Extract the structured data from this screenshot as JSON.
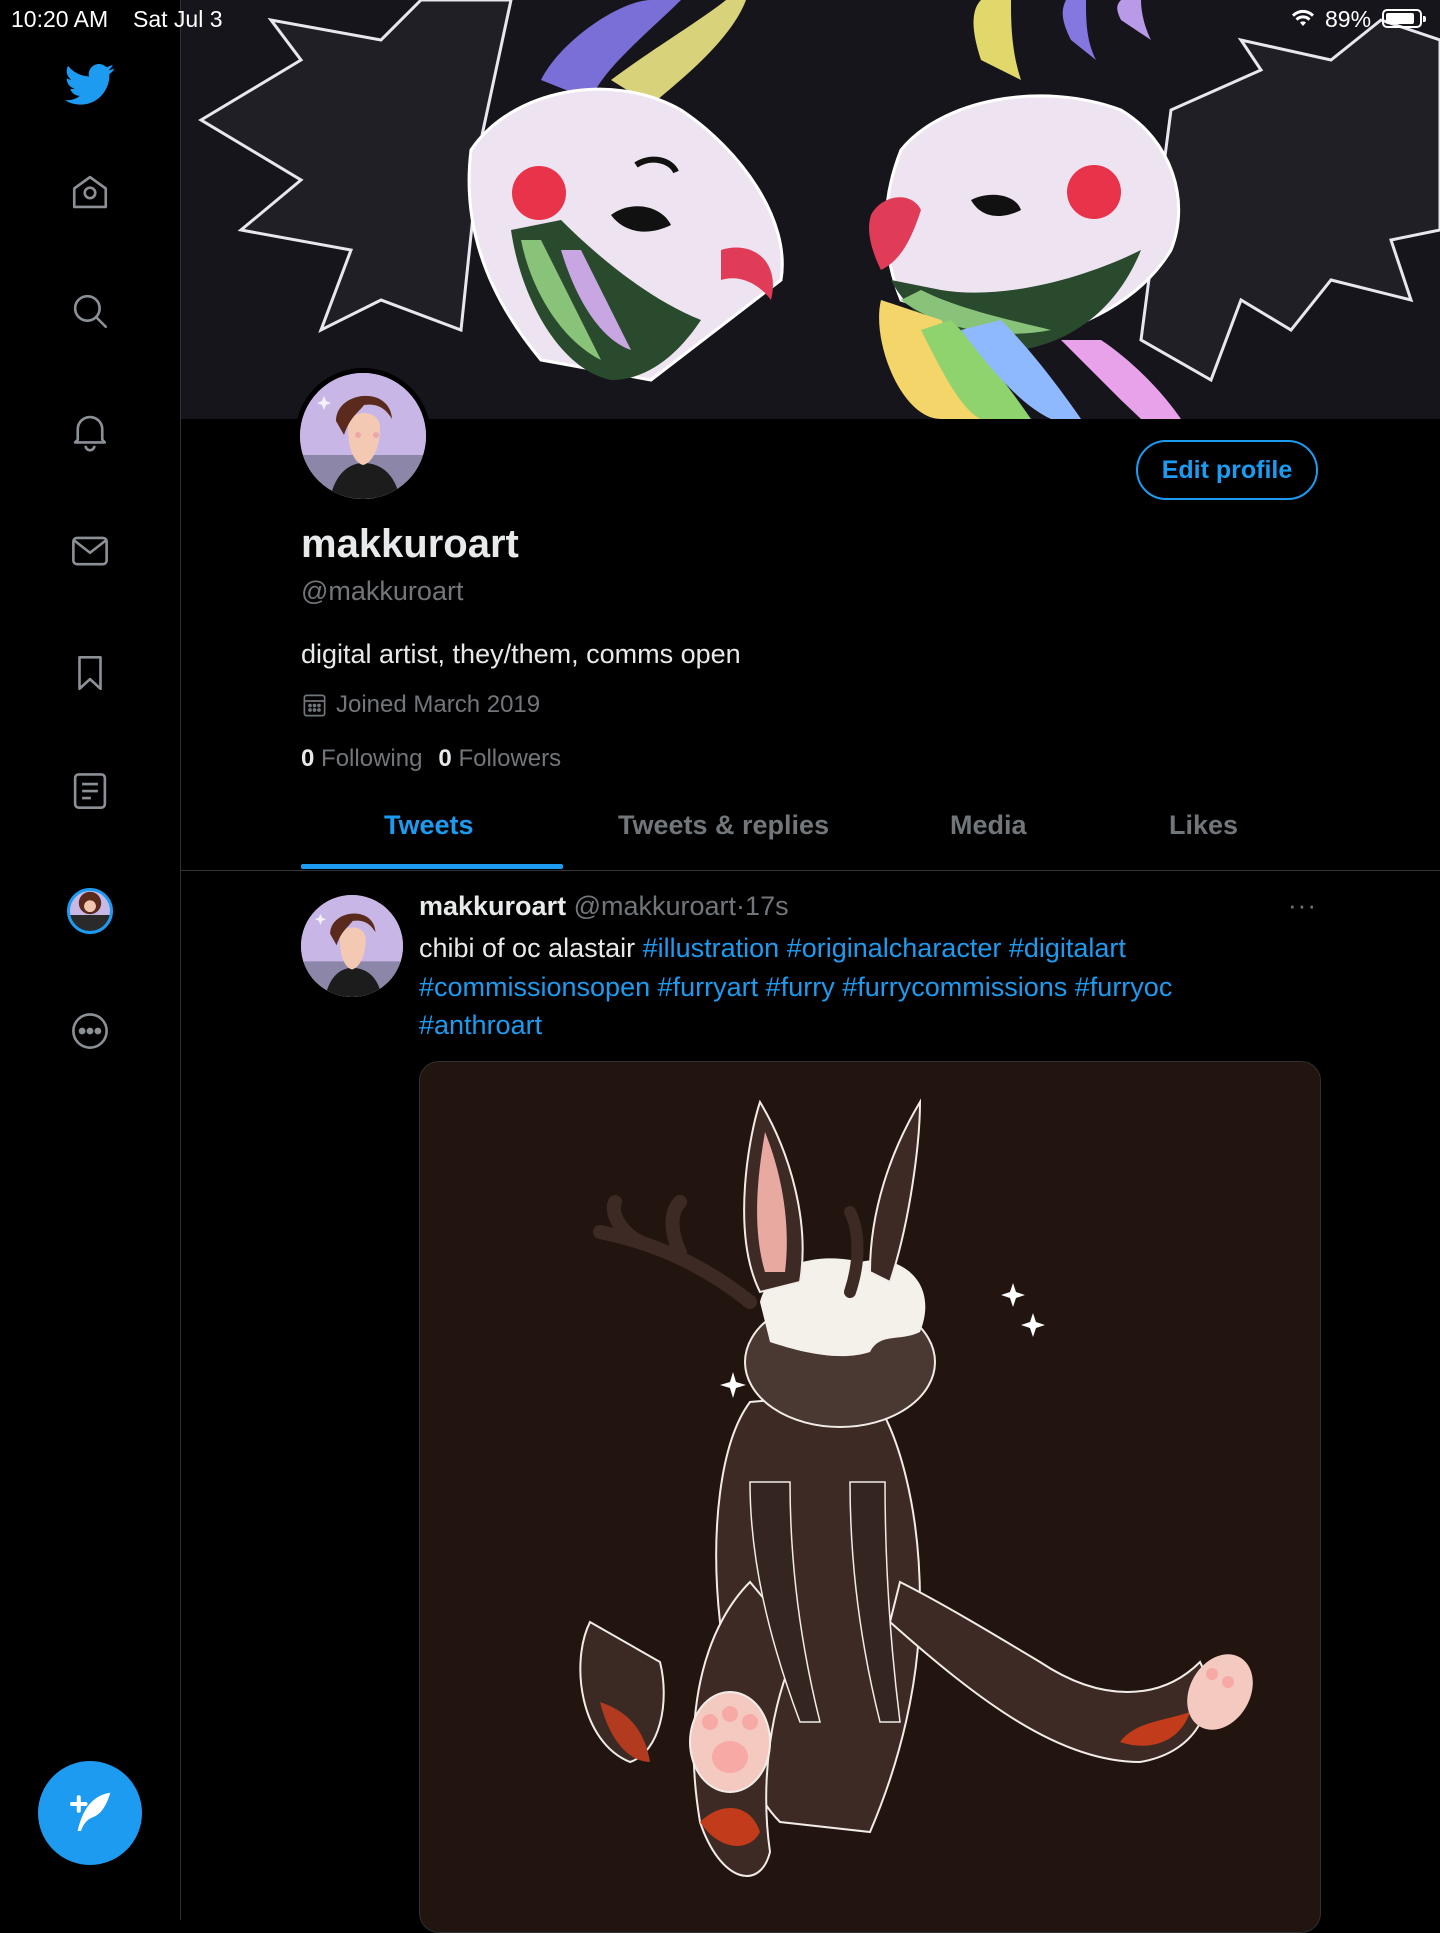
{
  "status_bar": {
    "time": "10:20 AM",
    "date": "Sat Jul 3",
    "battery_pct": "89%",
    "battery_level": 0.89
  },
  "sidebar": {
    "items": [
      {
        "icon": "twitter-logo-icon"
      },
      {
        "icon": "home-icon"
      },
      {
        "icon": "search-icon"
      },
      {
        "icon": "notifications-bell-icon"
      },
      {
        "icon": "messages-envelope-icon"
      },
      {
        "icon": "bookmark-icon"
      },
      {
        "icon": "lists-icon"
      },
      {
        "icon": "profile-avatar-icon"
      },
      {
        "icon": "more-icon"
      }
    ],
    "compose_icon": "compose-tweet-icon"
  },
  "profile": {
    "name": "makkuroart",
    "handle": "@makkuroart",
    "bio": "digital artist, they/them, comms open",
    "joined": "Joined March 2019",
    "following_count": "0",
    "following_label": "Following",
    "followers_count": "0",
    "followers_label": "Followers",
    "edit_button": "Edit profile"
  },
  "tabs": [
    {
      "label": "Tweets",
      "active": true
    },
    {
      "label": "Tweets & replies",
      "active": false
    },
    {
      "label": "Media",
      "active": false
    },
    {
      "label": "Likes",
      "active": false
    }
  ],
  "tweet": {
    "name": "makkuroart",
    "handle": "@makkuroart",
    "dot": "·",
    "time": "17s",
    "more": "···",
    "text": "chibi of oc alastair",
    "hashtags": [
      "#illustration",
      "#originalcharacter",
      "#digitalart",
      "#commissionsopen",
      "#furryart",
      "#furry",
      "#furrycommissions",
      "#furryoc",
      "#anthroart"
    ]
  },
  "colors": {
    "accent": "#1d9bf0",
    "background": "#000000",
    "secondary_text": "#71767b",
    "divider": "#2f3336"
  }
}
